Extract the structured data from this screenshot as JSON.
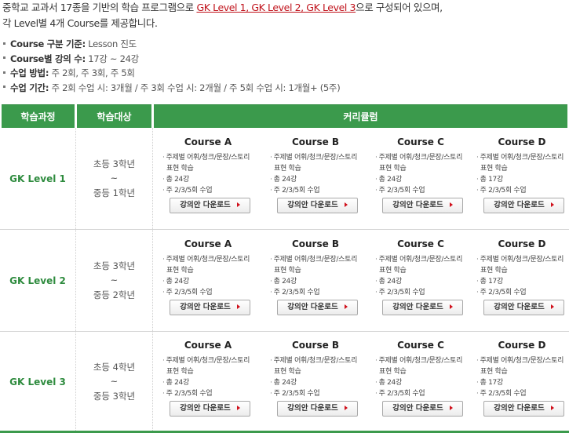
{
  "intro": {
    "line1_pre": "중학교 교과서 17종을 기반의 학습 프로그램으로 ",
    "line1_highlight": "GK Level 1, GK Level 2, GK Level 3",
    "line1_post": "으로 구성되어 있으며,",
    "line2": "각 Level별 4개 Course를 제공합니다."
  },
  "bullets": [
    {
      "key": "Course 구분 기준:",
      "value": " Lesson 진도"
    },
    {
      "key": "Course별 강의 수:",
      "value": " 17강 ~ 24강"
    },
    {
      "key": "수업 방법:",
      "value": " 주 2회, 주 3회, 주 5회"
    },
    {
      "key": "수업 기간:",
      "value": " 주 2회 수업 시: 3개월  /  주 3회 수업 시: 2개월  / 주 5회 수업 시: 1개월+ (5주)"
    }
  ],
  "table": {
    "headers": {
      "course": "학습과정",
      "target": "학습대상",
      "curriculum": "커리큘럼"
    },
    "rows": [
      {
        "level": "GK Level 1",
        "target": [
          "초등 3학년",
          "~",
          "중등 1학년"
        ],
        "courses": [
          {
            "title": "Course A",
            "line1": "주제별 어휘/청크/문장/스토리",
            "line1b": "표현 학습",
            "line2": "총 24강",
            "line3": "주 2/3/5회 수업",
            "button": "강의안 다운로드"
          },
          {
            "title": "Course B",
            "line1": "주제별 어휘/청크/문장/스토리",
            "line1b": "표현 학습",
            "line2": "총 24강",
            "line3": "주 2/3/5회 수업",
            "button": "강의안 다운로드"
          },
          {
            "title": "Course C",
            "line1": "주제별 어휘/청크/문장/스토리",
            "line1b": "표현 학습",
            "line2": "총 24강",
            "line3": "주 2/3/5회 수업",
            "button": "강의안 다운로드"
          },
          {
            "title": "Course D",
            "line1": "주제별 어휘/청크/문장/스토리",
            "line1b": "표현 학습",
            "line2": "총 17강",
            "line3": "주 2/3/5회 수업",
            "button": "강의안 다운로드"
          }
        ]
      },
      {
        "level": "GK Level 2",
        "target": [
          "초등 3학년",
          "~",
          "중등 2학년"
        ],
        "courses": [
          {
            "title": "Course A",
            "line1": "주제별 어휘/청크/문장/스토리",
            "line1b": "표현 학습",
            "line2": "총 24강",
            "line3": "주 2/3/5회 수업",
            "button": "강의안 다운로드"
          },
          {
            "title": "Course B",
            "line1": "주제별 어휘/청크/문장/스토리",
            "line1b": "표현 학습",
            "line2": "총 24강",
            "line3": "주 2/3/5회 수업",
            "button": "강의안 다운로드"
          },
          {
            "title": "Course C",
            "line1": "주제별 어휘/청크/문장/스토리",
            "line1b": "표현 학습",
            "line2": "총 24강",
            "line3": "주 2/3/5회 수업",
            "button": "강의안 다운로드"
          },
          {
            "title": "Course D",
            "line1": "주제별 어휘/청크/문장/스토리",
            "line1b": "표현 학습",
            "line2": "총 17강",
            "line3": "주 2/3/5회 수업",
            "button": "강의안 다운로드"
          }
        ]
      },
      {
        "level": "GK Level 3",
        "target": [
          "초등 4학년",
          "~",
          "중등 3학년"
        ],
        "courses": [
          {
            "title": "Course A",
            "line1": "주제별 어휘/청크/문장/스토리",
            "line1b": "표현 학습",
            "line2": "총 24강",
            "line3": "주 2/3/5회 수업",
            "button": "강의안 다운로드"
          },
          {
            "title": "Course B",
            "line1": "주제별 어휘/청크/문장/스토리",
            "line1b": "표현 학습",
            "line2": "총 24강",
            "line3": "주 2/3/5회 수업",
            "button": "강의안 다운로드"
          },
          {
            "title": "Course C",
            "line1": "주제별 어휘/청크/문장/스토리",
            "line1b": "표현 학습",
            "line2": "총 24강",
            "line3": "주 2/3/5회 수업",
            "button": "강의안 다운로드"
          },
          {
            "title": "Course D",
            "line1": "주제별 어휘/청크/문장/스토리",
            "line1b": "표현 학습",
            "line2": "총 17강",
            "line3": "주 2/3/5회 수업",
            "button": "강의안 다운로드"
          }
        ]
      }
    ]
  },
  "colors": {
    "header_green": "#3b9a4c",
    "level_green": "#2e8b3e",
    "highlight_red": "#c0121b",
    "arrow_red": "#d0101b"
  },
  "icons": {
    "button_arrow": "triangle-right-icon",
    "bullet": "square-bullet-icon"
  }
}
